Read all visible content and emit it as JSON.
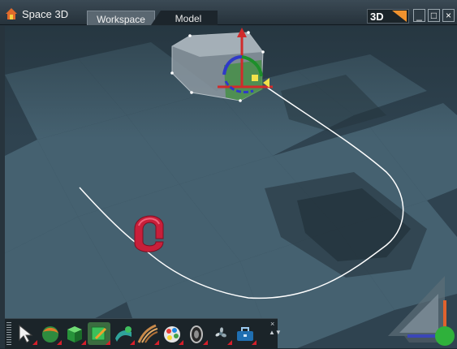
{
  "titlebar": {
    "app_title": "Space 3D",
    "tabs": [
      {
        "label": "Workspace",
        "active": true
      },
      {
        "label": "Model",
        "active": false
      }
    ],
    "view_mode": "3D",
    "buttons": {
      "minimize": "_",
      "maximize": "□",
      "close": "×"
    }
  },
  "toolbar": {
    "tools": [
      {
        "name": "select-arrow-icon"
      },
      {
        "name": "sphere-icon"
      },
      {
        "name": "cube-icon"
      },
      {
        "name": "box-edit-icon"
      },
      {
        "name": "extrude-icon"
      },
      {
        "name": "sweep-icon"
      },
      {
        "name": "paint-palette-icon"
      },
      {
        "name": "tire-icon"
      },
      {
        "name": "fan-icon"
      },
      {
        "name": "toolbox-icon"
      }
    ],
    "close": "×",
    "scroll": "▲▼"
  },
  "colors": {
    "accent": "#f0922e",
    "titlebar": "#2f3d47",
    "floor_light": "#3f5664",
    "floor_dark": "#2a3b45",
    "path_line": "#ffffff",
    "magnet_red": "#d92a45",
    "gizmo_green": "#33b534"
  }
}
